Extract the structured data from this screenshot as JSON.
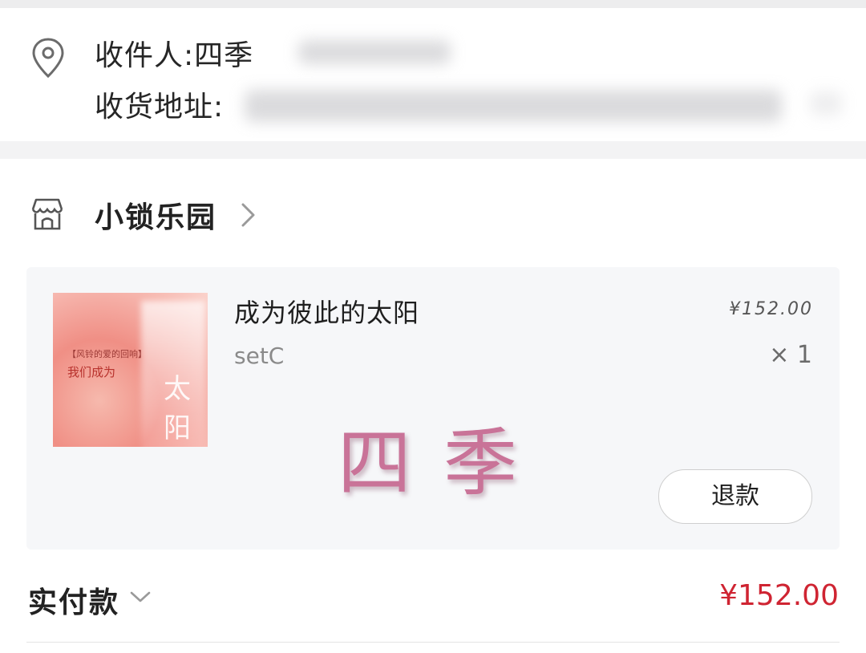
{
  "address": {
    "recipient_label": "收件人:",
    "recipient_name": "四季",
    "address_label": "收货地址:",
    "icon": "location-pin-icon"
  },
  "shop": {
    "name": "小锁乐园",
    "icon": "store-icon",
    "chevron_icon": "chevron-right-icon"
  },
  "product": {
    "title": "成为彼此的太阳",
    "variant": "setC",
    "price": "¥152.00",
    "quantity": "× 1",
    "image_caption_small": "【风铃的爱的回响】",
    "image_caption_main": "我们成为",
    "image_caption_large": "太阳"
  },
  "watermark": {
    "text": "四季",
    "color": "#c97398"
  },
  "actions": {
    "refund_label": "退款"
  },
  "payment": {
    "label": "实付款",
    "amount": "¥152.00",
    "amount_color": "#cf2432",
    "chevron_icon": "chevron-down-icon"
  }
}
